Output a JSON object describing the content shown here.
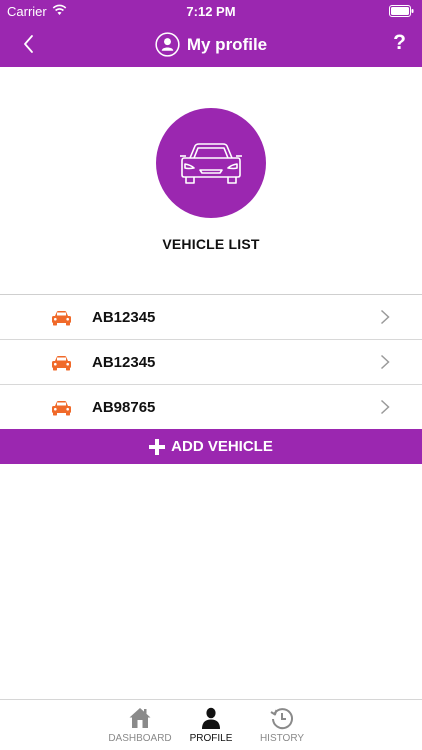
{
  "status_bar": {
    "carrier": "Carrier",
    "time": "7:12 PM"
  },
  "nav": {
    "title": "My profile",
    "help_label": "?",
    "back_icon": "chevron-left-icon",
    "avatar_icon": "user-circle-icon"
  },
  "hero": {
    "icon": "car-outline-icon",
    "section_title": "VEHICLE LIST"
  },
  "vehicles": [
    {
      "plate": "AB12345"
    },
    {
      "plate": "AB12345"
    },
    {
      "plate": "AB98765"
    }
  ],
  "add_button": {
    "label": "ADD VEHICLE"
  },
  "tabs": [
    {
      "label": "DASHBOARD",
      "icon": "home-icon",
      "active": false
    },
    {
      "label": "PROFILE",
      "icon": "person-icon",
      "active": true
    },
    {
      "label": "HISTORY",
      "icon": "history-clock-icon",
      "active": false
    }
  ],
  "colors": {
    "primary": "#9b27b0",
    "car_icon": "#f06a2a",
    "tab_inactive": "#8a8a8a",
    "tab_active": "#111111"
  }
}
